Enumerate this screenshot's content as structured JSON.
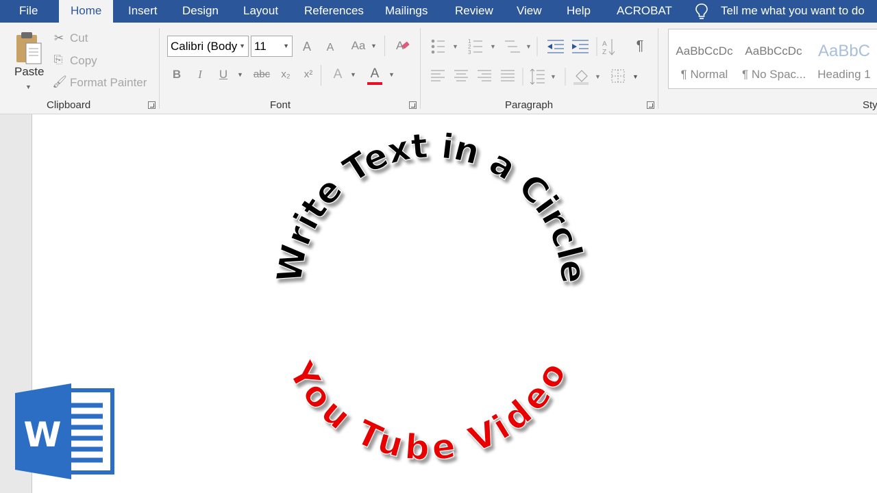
{
  "tabs": [
    {
      "id": "file",
      "label": "File"
    },
    {
      "id": "home",
      "label": "Home",
      "active": true
    },
    {
      "id": "insert",
      "label": "Insert"
    },
    {
      "id": "design",
      "label": "Design"
    },
    {
      "id": "layout",
      "label": "Layout"
    },
    {
      "id": "references",
      "label": "References"
    },
    {
      "id": "mailings",
      "label": "Mailings"
    },
    {
      "id": "review",
      "label": "Review"
    },
    {
      "id": "view",
      "label": "View"
    },
    {
      "id": "help",
      "label": "Help"
    },
    {
      "id": "acrobat",
      "label": "ACROBAT"
    }
  ],
  "tell_me": "Tell me what you want to do",
  "clipboard": {
    "group_label": "Clipboard",
    "paste": "Paste",
    "cut": "Cut",
    "copy": "Copy",
    "format_painter": "Format Painter"
  },
  "font": {
    "group_label": "Font",
    "family": "Calibri (Body",
    "size": "11",
    "bold": "B",
    "italic": "I",
    "underline": "U",
    "strike": "abc",
    "grow": "A",
    "shrink": "A",
    "change_case": "Aa",
    "text_effects": "A",
    "font_color": "A",
    "font_color_hex": "#e81123"
  },
  "paragraph": {
    "group_label": "Paragraph",
    "pilcrow": "¶"
  },
  "styles": {
    "group_label": "Sty",
    "items": [
      {
        "sample": "AaBbCcDc",
        "name": "¶ Normal"
      },
      {
        "sample": "AaBbCcDc",
        "name": "¶ No Spac..."
      },
      {
        "sample": "AaBbC",
        "name": "Heading 1"
      }
    ]
  },
  "document": {
    "arc_top": "Write Text in a Circle",
    "arc_bottom": "You Tube Video",
    "top_color": "#000000",
    "bottom_color": "#e80000"
  },
  "colors": {
    "tab_bar": "#2b579a",
    "ribbon": "#f3f3f3",
    "word_logo": "#2b6ec3"
  }
}
